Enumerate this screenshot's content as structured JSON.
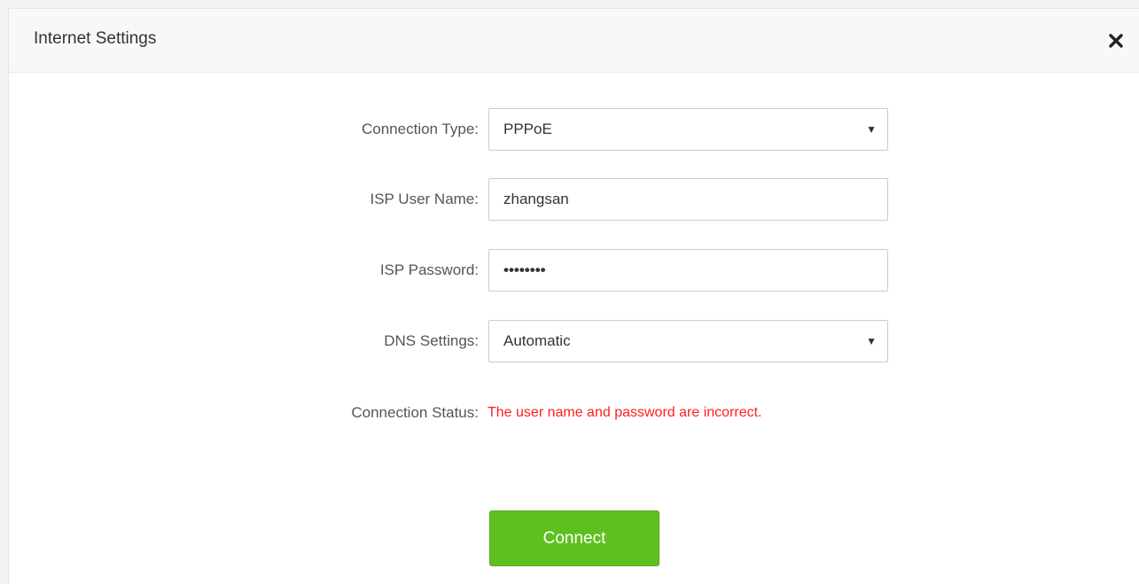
{
  "dialog": {
    "title": "Internet Settings",
    "close_icon": "close-icon"
  },
  "form": {
    "connection_type": {
      "label": "Connection Type:",
      "value": "PPPoE"
    },
    "isp_user_name": {
      "label": "ISP User Name:",
      "value": "zhangsan"
    },
    "isp_password": {
      "label": "ISP Password:",
      "masked_value": "••••••••"
    },
    "dns_settings": {
      "label": "DNS Settings:",
      "value": "Automatic"
    },
    "connection_status": {
      "label": "Connection Status:",
      "message": "The user name and password are incorrect."
    },
    "connect_label": "Connect"
  },
  "colors": {
    "error": "#ff1e1e",
    "primary_button": "#5ec01f"
  }
}
